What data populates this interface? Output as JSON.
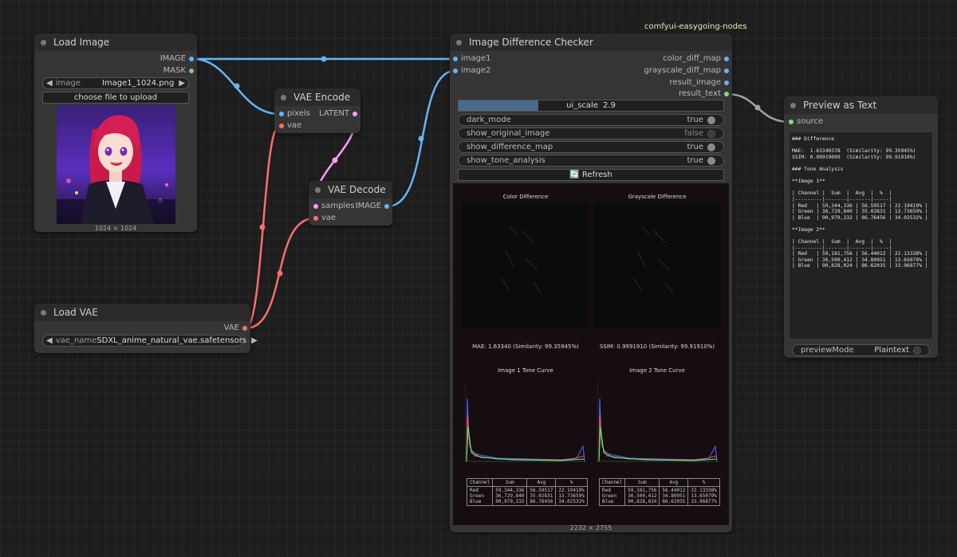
{
  "group_label": "comfyui-easygoing-nodes",
  "nodes": {
    "load_image": {
      "title": "Load Image",
      "outputs": [
        "IMAGE",
        "MASK"
      ],
      "image_widget": {
        "label": "image",
        "value": "Image1_1024.png"
      },
      "upload_label": "choose file to upload",
      "size_label": "1024 × 1024"
    },
    "vae_encode": {
      "title": "VAE Encode",
      "inputs": [
        "pixels",
        "vae"
      ],
      "output": "LATENT"
    },
    "vae_decode": {
      "title": "VAE Decode",
      "inputs": [
        "samples",
        "vae"
      ],
      "output": "IMAGE"
    },
    "load_vae": {
      "title": "Load VAE",
      "output": "VAE",
      "vae_widget": {
        "label": "vae_name",
        "value": "SDXL_anime_natural_vae.safetensors"
      }
    },
    "checker": {
      "title": "Image Difference Checker",
      "inputs": [
        "image1",
        "image2"
      ],
      "outputs": [
        "color_diff_map",
        "grayscale_diff_map",
        "result_image",
        "result_text"
      ],
      "ui_scale": {
        "label": "ui_scale",
        "value": "2.9"
      },
      "toggles": [
        {
          "label": "dark_mode",
          "value": "true",
          "on": true
        },
        {
          "label": "show_original_image",
          "value": "false",
          "on": false
        },
        {
          "label": "show_difference_map",
          "value": "true",
          "on": true
        },
        {
          "label": "show_tone_analysis",
          "value": "true",
          "on": true
        }
      ],
      "refresh_label": "🔄 Refresh",
      "result": {
        "color_title": "Color Difference",
        "gray_title": "Grayscale Difference",
        "mae_text": "MAE: 1.63340 (Similarity: 99.35945%)",
        "ssim_text": "SSIM: 0.9991910 (Similarity: 99.91910%)",
        "curve1_title": "Image 1 Tone Curve",
        "curve2_title": "Image 2 Tone Curve",
        "table_headers": [
          "Channel",
          "Sum",
          "Avg",
          "%"
        ],
        "table1": [
          [
            "Red",
            "59,344,336",
            "56.59517",
            "22.19419%"
          ],
          [
            "Green",
            "36,729,840",
            "35.02831",
            "13.73659%"
          ],
          [
            "Blue",
            "90,979,232",
            "86.76456",
            "34.02532%"
          ]
        ],
        "table2": [
          [
            "Red",
            "59,181,756",
            "56.44012",
            "22.13338%"
          ],
          [
            "Green",
            "36,500,412",
            "34.80951",
            "13.65079%"
          ],
          [
            "Blue",
            "90,828,024",
            "86.62035",
            "33.96877%"
          ]
        ]
      },
      "size_label": "2232 × 2755"
    },
    "preview_text": {
      "title": "Preview as Text",
      "input": "source",
      "text_lines": [
        "### Difference",
        "",
        "MAE:  1.63340378  (Similarity: 99.35945%)",
        "SSIM: 0.99919099  (Similarity: 99.91910%)",
        "",
        "### Tone Analysis",
        "",
        "**Image 1**",
        "",
        "| Channel |  Sum  |  Avg  |  %  |",
        "|---------|-------|-------|-----|",
        "| Red   | 59,344,336 | 56.59517 | 22.19419% |",
        "| Green | 36,729,840 | 35.02831 | 13.73659% |",
        "| Blue  | 90,979,232 | 86.76456 | 34.02532% |",
        "",
        "**Image 2**",
        "",
        "| Channel |  Sum  |  Avg  |  %  |",
        "|---------|-------|-------|-----|",
        "| Red   | 59,181,756 | 56.44012 | 22.13338% |",
        "| Green | 36,500,412 | 34.80951 | 13.65079% |",
        "| Blue  | 90,828,024 | 86.62035 | 33.96877% |"
      ],
      "mode_widget": {
        "label": "previewMode",
        "value": "Plaintext"
      }
    }
  },
  "colors": {
    "image_link": "#64b5f6",
    "vae_link": "#ff6e6e",
    "latent_link": "#ff9cf9",
    "string_link": "#a0a0a0",
    "mask_dot": "#81c784",
    "text_dot": "#7fe07f"
  }
}
